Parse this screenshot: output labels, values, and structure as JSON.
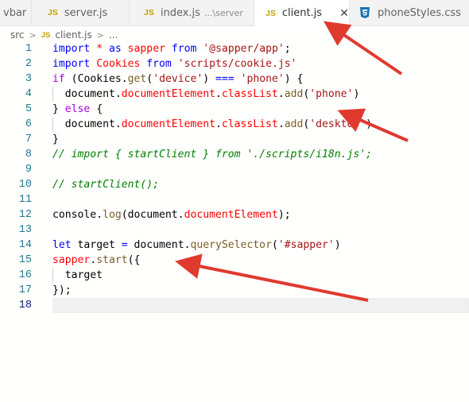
{
  "tabs": [
    {
      "label": "vbar"
    },
    {
      "icon": "JS",
      "label": "server.js"
    },
    {
      "icon": "JS",
      "label": "index.js",
      "description": "...\\server"
    },
    {
      "icon": "JS",
      "label": "client.js",
      "active": true
    },
    {
      "label": "phoneStyles.css"
    }
  ],
  "breadcrumb": {
    "folder": "src",
    "icon": "JS",
    "file": "client.js",
    "more": "..."
  },
  "editor": {
    "line_numbers": [
      "1",
      "2",
      "3",
      "4",
      "5",
      "6",
      "7",
      "8",
      "9",
      "10",
      "11",
      "12",
      "13",
      "14",
      "15",
      "16",
      "17",
      "18"
    ],
    "lines": [
      [
        [
          "k",
          "import"
        ],
        [
          "t",
          " "
        ],
        [
          "pl",
          "*"
        ],
        [
          "t",
          " "
        ],
        [
          "k",
          "as"
        ],
        [
          "t",
          " "
        ],
        [
          "pl",
          "sapper"
        ],
        [
          "t",
          " "
        ],
        [
          "k",
          "from"
        ],
        [
          "t",
          " "
        ],
        [
          "s",
          "'@sapper/app'"
        ],
        [
          "t",
          ";"
        ]
      ],
      [
        [
          "k",
          "import"
        ],
        [
          "t",
          " "
        ],
        [
          "pl",
          "Cookies"
        ],
        [
          "t",
          " "
        ],
        [
          "k",
          "from"
        ],
        [
          "t",
          " "
        ],
        [
          "s",
          "'scripts/cookie.js'"
        ]
      ],
      [
        [
          "kc",
          "if"
        ],
        [
          "t",
          " ("
        ],
        [
          "t",
          "Cookies"
        ],
        [
          "t",
          "."
        ],
        [
          "m",
          "get"
        ],
        [
          "t",
          "("
        ],
        [
          "s",
          "'device'"
        ],
        [
          "t",
          ") "
        ],
        [
          "k",
          "==="
        ],
        [
          "t",
          " "
        ],
        [
          "s",
          "'phone'"
        ],
        [
          "t",
          ") {"
        ]
      ],
      [
        [
          "t",
          "  document."
        ],
        [
          "pl",
          "documentElement"
        ],
        [
          "t",
          "."
        ],
        [
          "pl",
          "classList"
        ],
        [
          "t",
          "."
        ],
        [
          "m",
          "add"
        ],
        [
          "t",
          "("
        ],
        [
          "s",
          "'phone'"
        ],
        [
          "t",
          ")"
        ]
      ],
      [
        [
          "t",
          "} "
        ],
        [
          "kc",
          "else"
        ],
        [
          "t",
          " {"
        ]
      ],
      [
        [
          "t",
          "  document."
        ],
        [
          "pl",
          "documentElement"
        ],
        [
          "t",
          "."
        ],
        [
          "pl",
          "classList"
        ],
        [
          "t",
          "."
        ],
        [
          "m",
          "add"
        ],
        [
          "t",
          "("
        ],
        [
          "s",
          "'desktop'"
        ],
        [
          "t",
          ")"
        ]
      ],
      [
        [
          "t",
          "}"
        ]
      ],
      [
        [
          "c",
          "// import { startClient } from './scripts/i18n.js';"
        ]
      ],
      [],
      [
        [
          "c",
          "// startClient();"
        ]
      ],
      [],
      [
        [
          "t",
          "console."
        ],
        [
          "m",
          "log"
        ],
        [
          "t",
          "(document."
        ],
        [
          "pl",
          "documentElement"
        ],
        [
          "t",
          ");"
        ]
      ],
      [],
      [
        [
          "k",
          "let"
        ],
        [
          "t",
          " target "
        ],
        [
          "k",
          "="
        ],
        [
          "t",
          " document."
        ],
        [
          "m",
          "querySelector"
        ],
        [
          "t",
          "("
        ],
        [
          "s",
          "'#sapper'"
        ],
        [
          "t",
          ")"
        ]
      ],
      [
        [
          "pl",
          "sapper"
        ],
        [
          "t",
          "."
        ],
        [
          "m",
          "start"
        ],
        [
          "t",
          "({"
        ]
      ],
      [
        [
          "t",
          "  target"
        ]
      ],
      [
        [
          "t",
          "});"
        ]
      ],
      []
    ],
    "current_line": "18"
  },
  "colors": {
    "arrow": "#e03a2f",
    "js_icon": "#c5a106",
    "css_icon": "#1572b6"
  }
}
